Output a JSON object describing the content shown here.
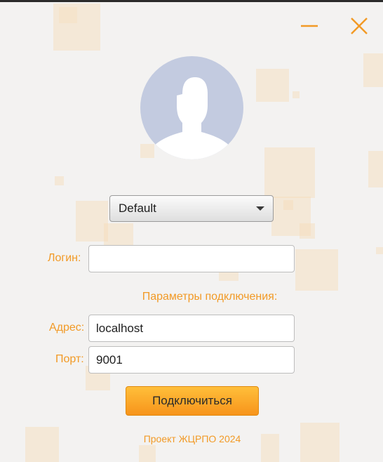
{
  "window": {
    "minimize_icon": "minimize-icon",
    "close_icon": "close-icon",
    "accent_color": "#f29a26"
  },
  "profile": {
    "avatar_icon": "user-avatar-icon",
    "selected": "Default"
  },
  "login": {
    "label": "Логин:",
    "value": ""
  },
  "connection": {
    "title": "Параметры подключения:",
    "address_label": "Адрес:",
    "address_value": "localhost",
    "port_label": "Порт:",
    "port_value": "9001"
  },
  "connect_button": {
    "label": "Подключиться"
  },
  "footer": {
    "text": "Проект ЖЦРПО 2024"
  }
}
